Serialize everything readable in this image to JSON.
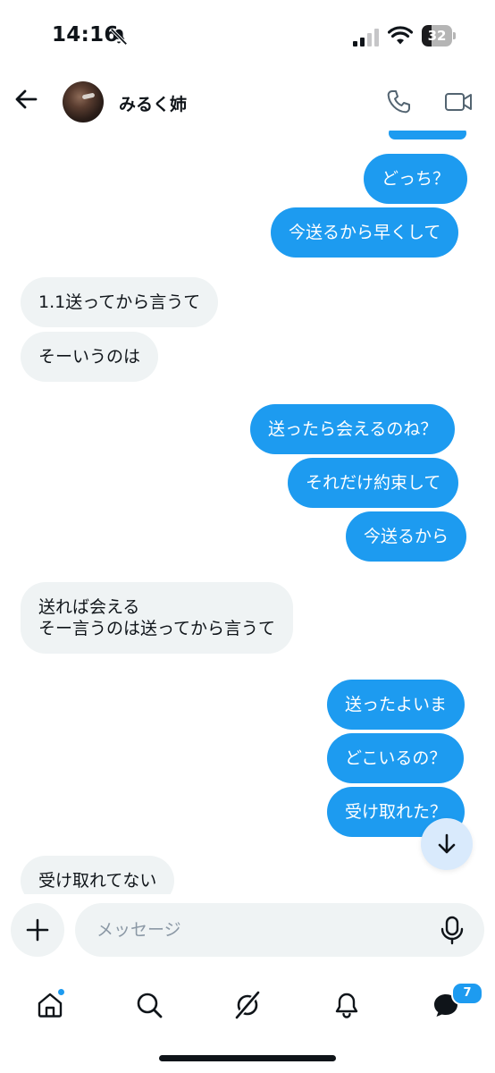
{
  "status_bar": {
    "time": "14:16",
    "battery_level": "32",
    "icons": [
      "bell-slash-icon",
      "cellular-signal-icon",
      "wifi-icon",
      "battery-icon"
    ]
  },
  "header": {
    "contact_name": "みるく姉",
    "icons": [
      "back-arrow-icon",
      "phone-icon",
      "video-camera-icon"
    ]
  },
  "messages": [
    {
      "side": "out",
      "text": ""
    },
    {
      "side": "out",
      "text": "どっち？"
    },
    {
      "side": "out",
      "text": "今送るから早くして"
    },
    {
      "side": "in",
      "text": "1.1送ってから言うて"
    },
    {
      "side": "in",
      "text": "そーいうのは"
    },
    {
      "side": "out",
      "text": "送ったら会えるのね？"
    },
    {
      "side": "out",
      "text": "それだけ約束して"
    },
    {
      "side": "out",
      "text": "今送るから"
    },
    {
      "side": "in",
      "text": "送れば会える"
    },
    {
      "side": "in",
      "text": "そー言うのは送ってから言うて"
    },
    {
      "side": "out",
      "text": "送ったよいま"
    },
    {
      "side": "out",
      "text": "どこいるの？"
    },
    {
      "side": "out",
      "text": "受け取れた？"
    },
    {
      "side": "in",
      "text": "受け取れてない"
    }
  ],
  "composer": {
    "placeholder": "メッセージ",
    "icons": [
      "plus-icon",
      "microphone-icon"
    ]
  },
  "bottom_nav": {
    "items": [
      {
        "name": "home",
        "icon": "home-icon",
        "has_dot": true
      },
      {
        "name": "search",
        "icon": "search-icon"
      },
      {
        "name": "grok",
        "icon": "grok-icon"
      },
      {
        "name": "notifications",
        "icon": "bell-icon"
      },
      {
        "name": "messages",
        "icon": "messages-icon",
        "badge": "7"
      }
    ]
  },
  "colors": {
    "accent": "#1d9bf0",
    "incoming_bubble": "#eff3f4",
    "text": "#0f1419",
    "scroll_button": "#d9eafc"
  },
  "scroll_down_icon": "arrow-down-icon"
}
